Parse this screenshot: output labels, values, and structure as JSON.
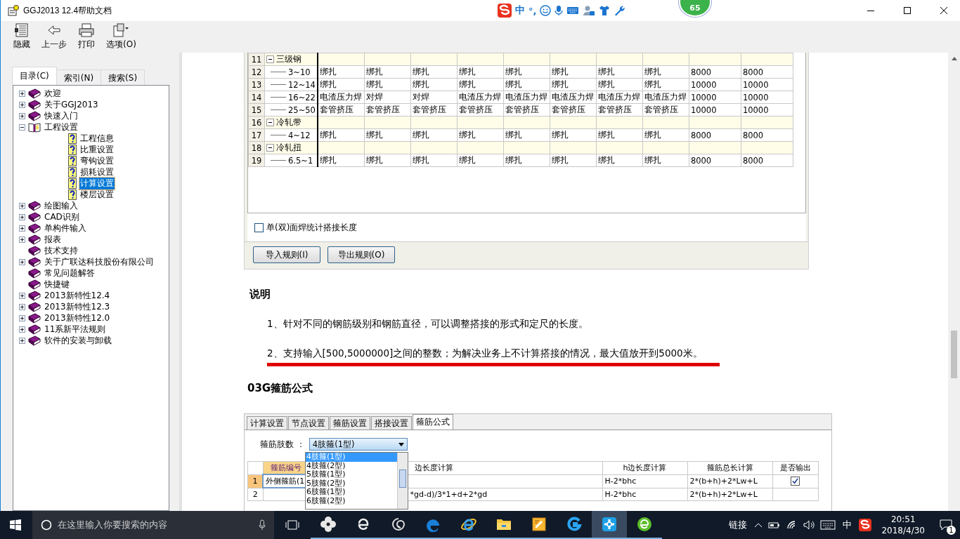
{
  "window": {
    "title": "GGJ2013 12.4帮助文档"
  },
  "ime_bar": {
    "mode": "中",
    "punct": "°,"
  },
  "badge": {
    "text": "65"
  },
  "toolbar": [
    {
      "label": "隐藏",
      "kind": "hide"
    },
    {
      "label": "上一步",
      "kind": "back"
    },
    {
      "label": "打印",
      "kind": "print"
    },
    {
      "label": "选项(O)",
      "kind": "options"
    }
  ],
  "nav_tabs": [
    {
      "label": "目录(C)",
      "selected": true
    },
    {
      "label": "索引(N)",
      "selected": false
    },
    {
      "label": "搜索(S)",
      "selected": false
    }
  ],
  "tree": [
    {
      "label": "欢迎",
      "kind": "book",
      "expanded": false,
      "selected": false
    },
    {
      "label": "关于GGJ2013",
      "kind": "book",
      "expanded": false,
      "selected": false
    },
    {
      "label": "快速入门",
      "kind": "book",
      "expanded": false,
      "selected": false
    },
    {
      "label": "工程设置",
      "kind": "book",
      "expanded": true,
      "selected": false,
      "children": [
        {
          "label": "工程信息",
          "kind": "topic",
          "selected": false
        },
        {
          "label": "比重设置",
          "kind": "topic",
          "selected": false
        },
        {
          "label": "弯钩设置",
          "kind": "topic",
          "selected": false
        },
        {
          "label": "损耗设置",
          "kind": "topic",
          "selected": false
        },
        {
          "label": "计算设置",
          "kind": "topic",
          "selected": true
        },
        {
          "label": "楼层设置",
          "kind": "topic",
          "selected": false
        }
      ]
    },
    {
      "label": "绘图输入",
      "kind": "book",
      "expanded": false,
      "selected": false
    },
    {
      "label": "CAD识别",
      "kind": "book",
      "expanded": false,
      "selected": false
    },
    {
      "label": "单构件输入",
      "kind": "book",
      "expanded": false,
      "selected": false
    },
    {
      "label": "报表",
      "kind": "book",
      "expanded": false,
      "selected": false
    },
    {
      "label": "技术支持",
      "kind": "leaf",
      "selected": false
    },
    {
      "label": "关于广联达科技股份有限公司",
      "kind": "book",
      "expanded": false,
      "selected": false
    },
    {
      "label": "常见问题解答",
      "kind": "leaf",
      "selected": false
    },
    {
      "label": "快捷键",
      "kind": "leaf",
      "selected": false
    },
    {
      "label": "2013新特性12.4",
      "kind": "book",
      "expanded": false,
      "selected": false
    },
    {
      "label": "2013新特性12.3",
      "kind": "book",
      "expanded": false,
      "selected": false
    },
    {
      "label": "2013新特性12.0",
      "kind": "book",
      "expanded": false,
      "selected": false
    },
    {
      "label": "11系新平法规则",
      "kind": "book",
      "expanded": false,
      "selected": false
    },
    {
      "label": "软件的安装与卸载",
      "kind": "book",
      "expanded": false,
      "selected": false
    }
  ],
  "rules_table": {
    "rows": [
      {
        "no": "11",
        "name": "三级钢",
        "kind": "group"
      },
      {
        "no": "12",
        "name": "3~10",
        "kind": "item",
        "cells": [
          "绑扎",
          "绑扎",
          "绑扎",
          "绑扎",
          "绑扎",
          "绑扎",
          "绑扎",
          "绑扎",
          "8000",
          "8000"
        ]
      },
      {
        "no": "13",
        "name": "12~14",
        "kind": "item",
        "cells": [
          "绑扎",
          "绑扎",
          "绑扎",
          "绑扎",
          "绑扎",
          "绑扎",
          "绑扎",
          "绑扎",
          "10000",
          "10000"
        ]
      },
      {
        "no": "14",
        "name": "16~22",
        "kind": "item",
        "cells": [
          "电渣压力焊",
          "对焊",
          "对焊",
          "电渣压力焊",
          "电渣压力焊",
          "电渣压力焊",
          "电渣压力焊",
          "电渣压力焊",
          "10000",
          "10000"
        ]
      },
      {
        "no": "15",
        "name": "25~50",
        "kind": "item",
        "cells": [
          "套管挤压",
          "套管挤压",
          "套管挤压",
          "套管挤压",
          "套管挤压",
          "套管挤压",
          "套管挤压",
          "套管挤压",
          "10000",
          "10000"
        ]
      },
      {
        "no": "16",
        "name": "冷轧带",
        "kind": "group"
      },
      {
        "no": "17",
        "name": "4~12",
        "kind": "item",
        "cells": [
          "绑扎",
          "绑扎",
          "绑扎",
          "绑扎",
          "绑扎",
          "绑扎",
          "绑扎",
          "绑扎",
          "8000",
          "8000"
        ]
      },
      {
        "no": "18",
        "name": "冷轧扭",
        "kind": "group"
      },
      {
        "no": "19",
        "name": "6.5~1",
        "kind": "item",
        "cells": [
          "绑扎",
          "绑扎",
          "绑扎",
          "绑扎",
          "绑扎",
          "绑扎",
          "绑扎",
          "绑扎",
          "8000",
          "8000"
        ]
      }
    ]
  },
  "weld_option": {
    "label": "单(双)面焊统计搭接长度",
    "checked": false
  },
  "rule_buttons": [
    "导入规则(I)",
    "导出规则(O)"
  ],
  "notes_heading": "说明",
  "notes": [
    {
      "text": "1、针对不同的钢筋级别和钢筋直径，可以调整搭接的形式和定尺的长度。",
      "highlighted": false
    },
    {
      "text": "2、支持输入[500,5000000]之间的整数；为解决业务上不计算搭接的情况，最大值放开到5000米。",
      "highlighted": true
    }
  ],
  "formula_heading": "03G箍筋公式",
  "formula_panel": {
    "tabs": [
      {
        "label": "计算设置",
        "selected": false
      },
      {
        "label": "节点设置",
        "selected": false
      },
      {
        "label": "箍筋设置",
        "selected": false
      },
      {
        "label": "搭接设置",
        "selected": false
      },
      {
        "label": "箍筋公式",
        "selected": true
      }
    ],
    "count_label": "箍筋肢数 ：",
    "count_value": "4肢箍(1型)",
    "options": [
      {
        "label": "4肢箍(1型)",
        "selected": true
      },
      {
        "label": "4肢箍(2型)",
        "selected": false
      },
      {
        "label": "5肢箍(1型)",
        "selected": false
      },
      {
        "label": "5肢箍(2型)",
        "selected": false
      },
      {
        "label": "6肢箍(1型)",
        "selected": false
      },
      {
        "label": "6肢箍(2型)",
        "selected": false
      }
    ],
    "columns": [
      "箍筋编号",
      "边长度计算",
      "h边长度计算",
      "箍筋总长计算",
      "是否输出"
    ],
    "rows": [
      {
        "no": "1",
        "id": "外侧箍筋(1",
        "h": "H-2*bhc",
        "total": "2*(b+h)+2*Lw+L",
        "output": {
          "checked": true
        }
      },
      {
        "no": "2",
        "b": "*gd-d)/3*1+d+2*gd",
        "h": "H-2*bhc",
        "total": "2*(b+h)+2*Lw+L"
      }
    ]
  },
  "taskbar": {
    "search_placeholder": "在这里输入你要搜索的内容",
    "apps": [
      {
        "kind": "fan",
        "active": false
      },
      {
        "kind": "ie-outline",
        "active": false
      },
      {
        "kind": "swirl",
        "active": false
      },
      {
        "kind": "edge",
        "active": false
      },
      {
        "kind": "ie",
        "active": false
      },
      {
        "kind": "folder",
        "active": false
      },
      {
        "kind": "notes",
        "active": false
      },
      {
        "kind": "g-app",
        "active": false
      },
      {
        "kind": "plus-app",
        "active": true
      },
      {
        "kind": "green-ie",
        "active": false
      }
    ],
    "link_label": "链接",
    "ime": "中",
    "time": "20:51",
    "date": "2018/4/30",
    "notifications": "1"
  }
}
